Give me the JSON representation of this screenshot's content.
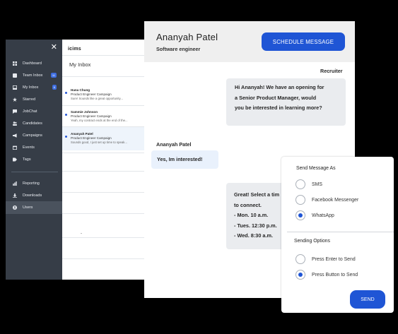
{
  "sidebar": {
    "items": [
      {
        "label": "Dashboard",
        "icon": "dashboard-icon"
      },
      {
        "label": "Team Inbox",
        "icon": "team-inbox-icon",
        "badge": "11"
      },
      {
        "label": "My Inbox",
        "icon": "inbox-icon",
        "badge": "6"
      },
      {
        "label": "Starred",
        "icon": "star-icon"
      },
      {
        "label": "JobChat",
        "icon": "chat-icon"
      },
      {
        "label": "Candidates",
        "icon": "candidates-icon"
      },
      {
        "label": "Campaigns",
        "icon": "megaphone-icon"
      },
      {
        "label": "Events",
        "icon": "calendar-icon"
      },
      {
        "label": "Tags",
        "icon": "tag-icon"
      },
      {
        "label": "Reporting",
        "icon": "reporting-icon"
      },
      {
        "label": "Downloads",
        "icon": "download-icon"
      },
      {
        "label": "Users",
        "icon": "user-icon",
        "active": true
      }
    ]
  },
  "inbox": {
    "brand": "icims",
    "title": "My Inbox",
    "messages": [
      {
        "name": "Hana Chung",
        "campaign": "Product Engineer Campaign",
        "preview": "Sure! Sounds like a great opportunity..."
      },
      {
        "name": "Sammie Johnson",
        "campaign": "Product Engineer Campaign",
        "preview": "Yeah, my contract ends at the end of the..."
      },
      {
        "name": "Ananyah Patel",
        "campaign": "Product Engineer Campaign",
        "preview": "Sounds good, I just set up time to speak..."
      }
    ]
  },
  "chat": {
    "contact_name": "Ananyah Patel",
    "contact_role": "Software engineer",
    "schedule_label": "SCHEDULE MESSAGE",
    "recruiter_label": "Recruiter",
    "recruiter_message": [
      "Hi Ananyah! We have an opening for",
      "a Senior Product Manager, would",
      "you be interested in learning more?"
    ],
    "candidate_label": "Ananyah Patel",
    "candidate_message": "Yes, Im interested!",
    "schedule_message": [
      "Great! Select a tim",
      "to connect.",
      "- Mon. 10 a.m.",
      "- Tues. 12:30 p.m.",
      "- Wed. 8:30 a.m."
    ]
  },
  "send_options": {
    "send_as_heading": "Send Message As",
    "send_as": [
      {
        "label": "SMS",
        "checked": false
      },
      {
        "label": "Facebook Messenger",
        "checked": false
      },
      {
        "label": "WhatsApp",
        "checked": true
      }
    ],
    "sending_heading": "Sending Options",
    "sending": [
      {
        "label": "Press Enter to Send",
        "checked": false
      },
      {
        "label": "Press Button to Send",
        "checked": true
      }
    ],
    "send_label": "SEND"
  },
  "colors": {
    "accent": "#1f55d5",
    "sidebar": "#363d47"
  }
}
